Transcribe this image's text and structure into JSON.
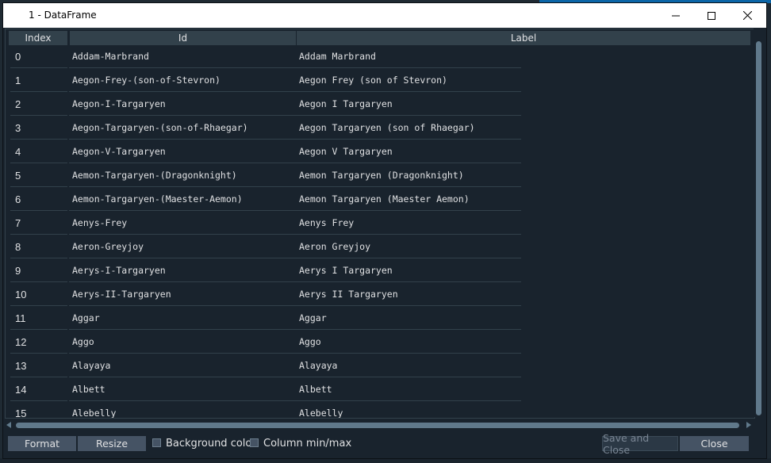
{
  "window": {
    "title": "1 - DataFrame",
    "controls": {
      "minimize": "—",
      "maximize": "□",
      "close": "✕"
    }
  },
  "table": {
    "columns": [
      "Index",
      "Id",
      "Label"
    ],
    "rows": [
      {
        "index": "0",
        "id": "Addam-Marbrand",
        "label": "Addam Marbrand"
      },
      {
        "index": "1",
        "id": "Aegon-Frey-(son-of-Stevron)",
        "label": "Aegon Frey (son of Stevron)"
      },
      {
        "index": "2",
        "id": "Aegon-I-Targaryen",
        "label": "Aegon I Targaryen"
      },
      {
        "index": "3",
        "id": "Aegon-Targaryen-(son-of-Rhaegar)",
        "label": "Aegon Targaryen (son of Rhaegar)"
      },
      {
        "index": "4",
        "id": "Aegon-V-Targaryen",
        "label": "Aegon V Targaryen"
      },
      {
        "index": "5",
        "id": "Aemon-Targaryen-(Dragonknight)",
        "label": "Aemon Targaryen (Dragonknight)"
      },
      {
        "index": "6",
        "id": "Aemon-Targaryen-(Maester-Aemon)",
        "label": "Aemon Targaryen (Maester Aemon)"
      },
      {
        "index": "7",
        "id": "Aenys-Frey",
        "label": "Aenys Frey"
      },
      {
        "index": "8",
        "id": "Aeron-Greyjoy",
        "label": "Aeron Greyjoy"
      },
      {
        "index": "9",
        "id": "Aerys-I-Targaryen",
        "label": "Aerys I Targaryen"
      },
      {
        "index": "10",
        "id": "Aerys-II-Targaryen",
        "label": "Aerys II Targaryen"
      },
      {
        "index": "11",
        "id": "Aggar",
        "label": "Aggar"
      },
      {
        "index": "12",
        "id": "Aggo",
        "label": "Aggo"
      },
      {
        "index": "13",
        "id": "Alayaya",
        "label": "Alayaya"
      },
      {
        "index": "14",
        "id": "Albett",
        "label": "Albett"
      },
      {
        "index": "15",
        "id": "Alebelly",
        "label": "Alebelly"
      }
    ]
  },
  "footer": {
    "format_label": "Format",
    "resize_label": "Resize",
    "background_color_label": "Background color",
    "column_minmax_label": "Column min/max",
    "save_close_label": "Save and Close",
    "close_label": "Close"
  }
}
